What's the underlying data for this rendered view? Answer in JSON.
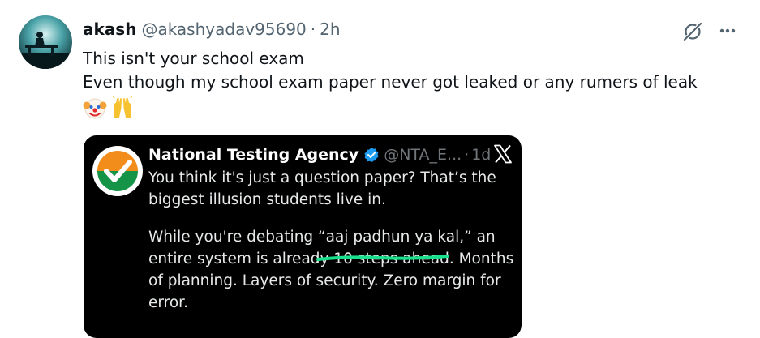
{
  "tweet": {
    "author_name": "akash",
    "author_handle": "@akashyadav95690",
    "separator": "·",
    "timestamp": "2h",
    "text_line1": "This isn't your school exam",
    "text_line2": "Even though my school exam paper never got leaked or any rumers of leak",
    "emojis": [
      "clown-face",
      "raising-hands"
    ]
  },
  "quoted": {
    "author_name": "National Testing Agency",
    "author_handle": "@NTA_E...",
    "separator": "·",
    "timestamp": "1d",
    "line1": "You think it's just a question paper? That’s the",
    "line2": "biggest illusion students live in.",
    "line3": "While you're debating “aaj padhun ya kal,” an",
    "line4": "entire system is already 10 steps ahead. Months",
    "line5": "of planning. Layers of security. Zero margin for",
    "line6": "error."
  },
  "colors": {
    "text_primary": "#0f1419",
    "text_secondary": "#536471",
    "verified_blue": "#1d9bf0",
    "highlight_green": "#19e08a",
    "media_background": "#000000"
  }
}
